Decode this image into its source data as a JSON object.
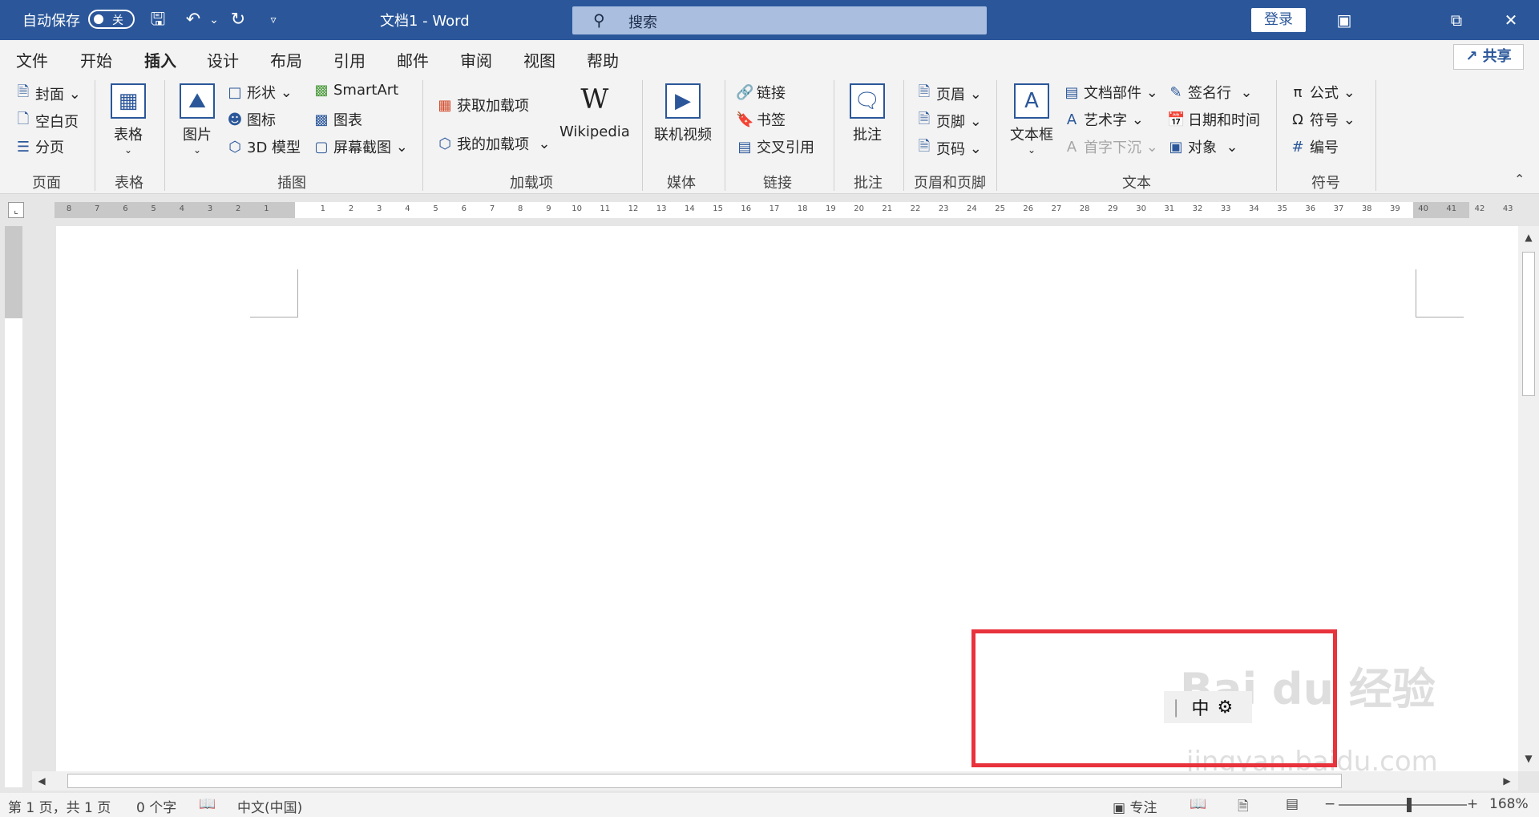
{
  "titlebar": {
    "autosave_label": "自动保存",
    "autosave_state": "关",
    "doc_title": "文档1  -  Word",
    "search_placeholder": "搜索",
    "login_label": "登录"
  },
  "tabs": [
    "文件",
    "开始",
    "插入",
    "设计",
    "布局",
    "引用",
    "邮件",
    "审阅",
    "视图",
    "帮助"
  ],
  "active_tab": "插入",
  "share_label": "共享",
  "ribbon": {
    "pages": {
      "cover": "封面",
      "blank": "空白页",
      "break": "分页",
      "group": "页面"
    },
    "tables": {
      "table": "表格",
      "group": "表格"
    },
    "illustrations": {
      "picture": "图片",
      "shapes": "形状",
      "icons": "图标",
      "model3d": "3D 模型",
      "smartart": "SmartArt",
      "chart": "图表",
      "screenshot": "屏幕截图",
      "group": "插图"
    },
    "addins": {
      "get": "获取加载项",
      "mine": "我的加载项",
      "wikipedia": "Wikipedia",
      "group": "加载项"
    },
    "media": {
      "video": "联机视频",
      "group": "媒体"
    },
    "links": {
      "link": "链接",
      "bookmark": "书签",
      "crossref": "交叉引用",
      "group": "链接"
    },
    "comments": {
      "comment": "批注",
      "group": "批注"
    },
    "headerfooter": {
      "header": "页眉",
      "footer": "页脚",
      "pagenum": "页码",
      "group": "页眉和页脚"
    },
    "text": {
      "textbox": "文本框",
      "quickparts": "文档部件",
      "wordart": "艺术字",
      "dropcap": "首字下沉",
      "sigline": "签名行",
      "datetime": "日期和时间",
      "object": "对象",
      "group": "文本"
    },
    "symbols": {
      "equation": "公式",
      "symbol": "符号",
      "number": "编号",
      "group": "符号"
    }
  },
  "ruler_numbers": [
    "8",
    "7",
    "6",
    "5",
    "4",
    "3",
    "2",
    "1",
    "",
    "1",
    "2",
    "3",
    "4",
    "5",
    "6",
    "7",
    "8",
    "9",
    "10",
    "11",
    "12",
    "13",
    "14",
    "15",
    "16",
    "17",
    "18",
    "19",
    "20",
    "21",
    "22",
    "23",
    "24",
    "25",
    "26",
    "27",
    "28",
    "29",
    "30",
    "31",
    "32",
    "33",
    "34",
    "35",
    "36",
    "37",
    "38",
    "39",
    "40",
    "41",
    "42",
    "43"
  ],
  "ime": {
    "mode": "中"
  },
  "watermark": {
    "logo": "Bai du 经验",
    "url": "jingyan.baidu.com"
  },
  "status": {
    "page": "第 1 页，共 1 页",
    "words": "0 个字",
    "language": "中文(中国)",
    "focus": "专注",
    "zoom": "168%"
  },
  "colors": {
    "accent": "#2b579a",
    "highlight": "#e8323c"
  }
}
